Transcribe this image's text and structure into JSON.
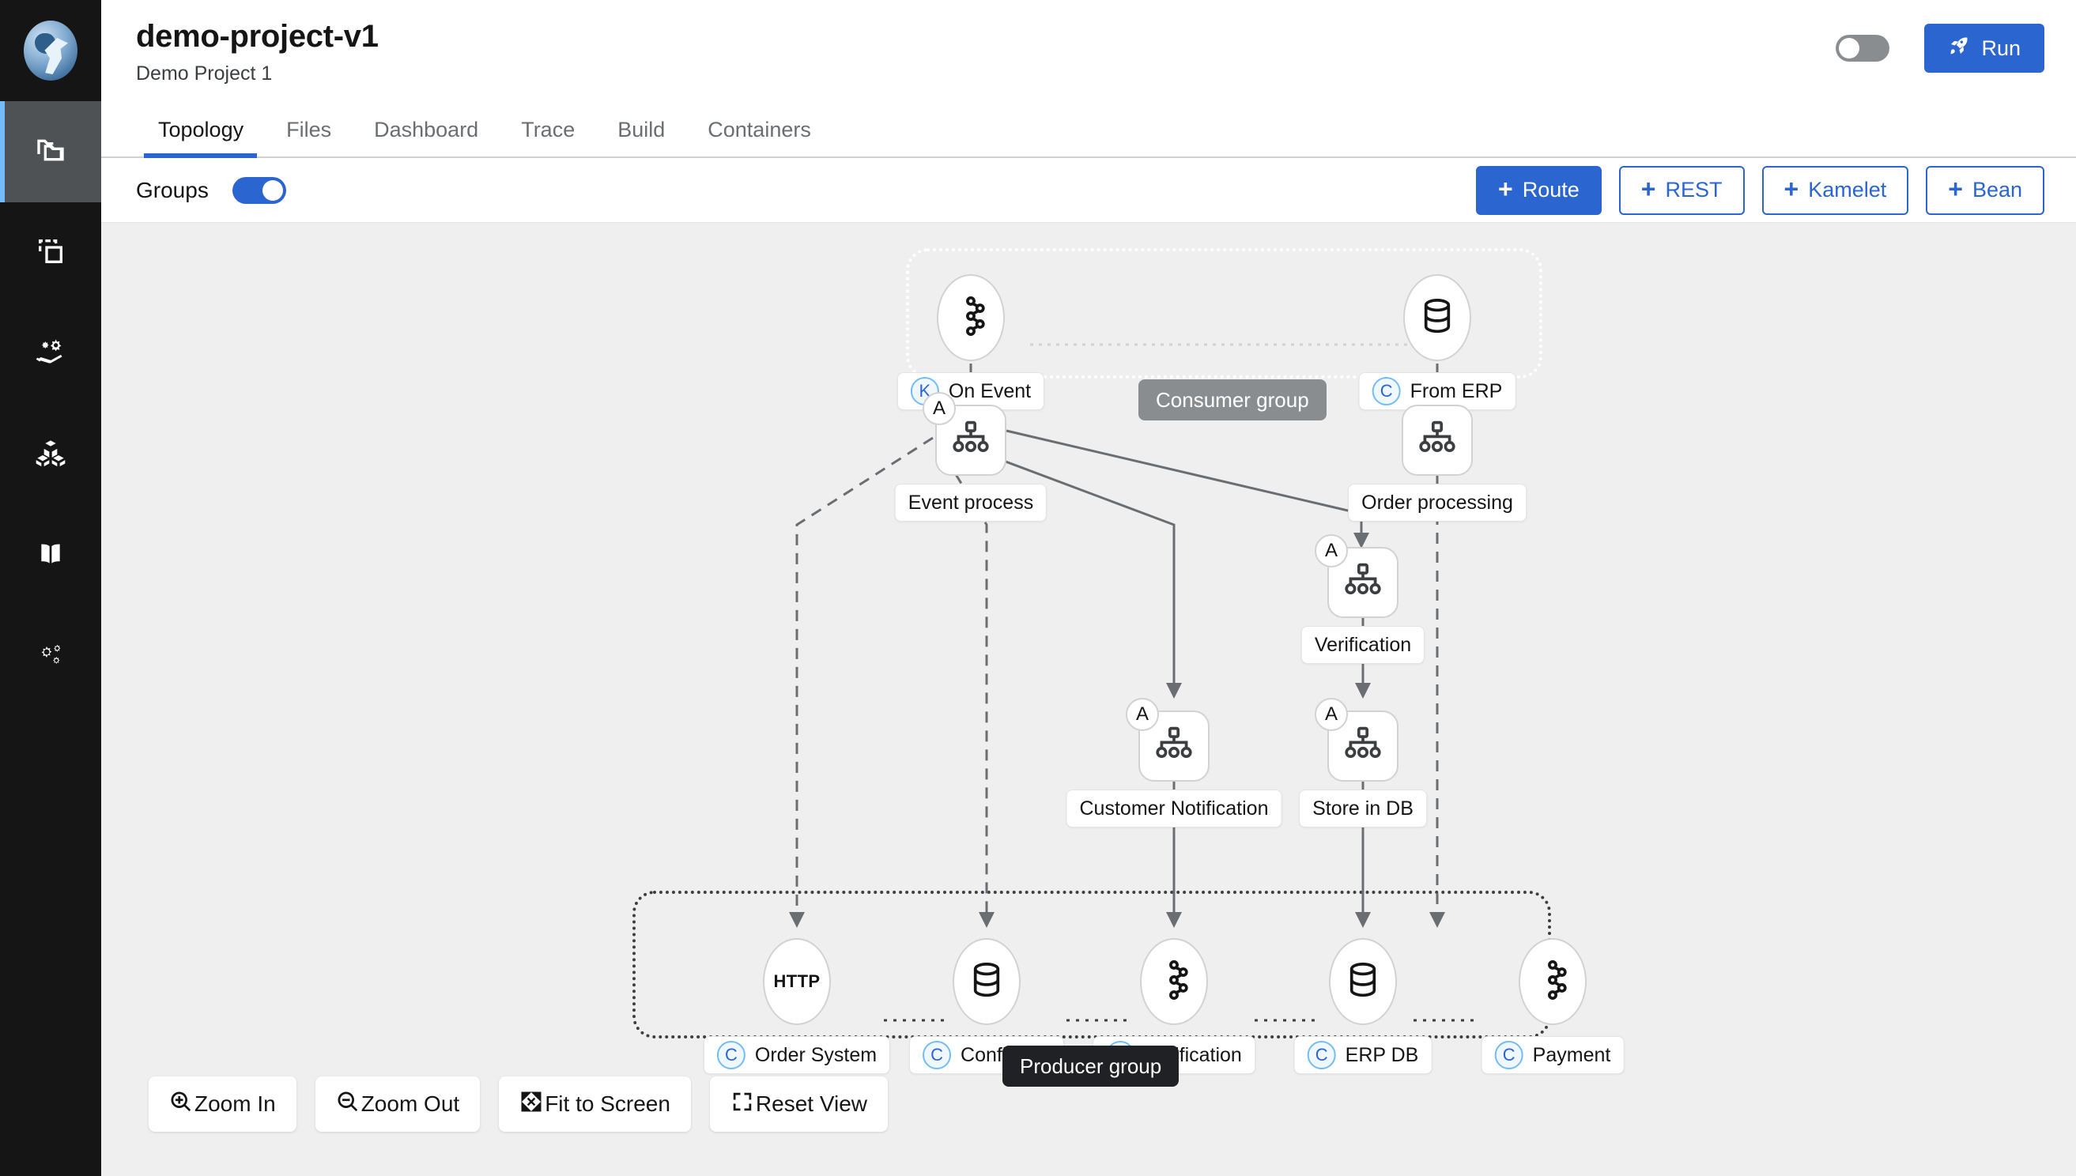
{
  "sidebar": {
    "logo": "karavan-logo",
    "items": [
      {
        "name": "projects",
        "icon": "folders-icon",
        "active": true
      },
      {
        "name": "templates",
        "icon": "copy-icon",
        "active": false
      },
      {
        "name": "services",
        "icon": "services-hand-gear-icon",
        "active": false
      },
      {
        "name": "containers",
        "icon": "cubes-icon",
        "active": false
      },
      {
        "name": "knowledgebase",
        "icon": "book-icon",
        "active": false
      },
      {
        "name": "configuration",
        "icon": "gears-icon",
        "active": false
      }
    ]
  },
  "header": {
    "title": "demo-project-v1",
    "subtitle": "Demo Project 1",
    "dev_mode_toggle": {
      "name": "dev-mode-toggle",
      "on": false
    },
    "run_label": "Run",
    "run_icon": "rocket-icon"
  },
  "tabs": [
    {
      "label": "Topology",
      "active": true
    },
    {
      "label": "Files",
      "active": false
    },
    {
      "label": "Dashboard",
      "active": false
    },
    {
      "label": "Trace",
      "active": false
    },
    {
      "label": "Build",
      "active": false
    },
    {
      "label": "Containers",
      "active": false
    }
  ],
  "toolbar": {
    "groups_label": "Groups",
    "groups_toggle_on": true,
    "actions": [
      {
        "label": "Route",
        "primary": true
      },
      {
        "label": "REST",
        "primary": false
      },
      {
        "label": "Kamelet",
        "primary": false
      },
      {
        "label": "Bean",
        "primary": false
      }
    ]
  },
  "topology": {
    "group_tags": [
      {
        "label": "Consumer group",
        "style": "consumer"
      },
      {
        "label": "Producer group",
        "style": "producer"
      }
    ],
    "nodes": [
      {
        "id": "on-event",
        "label": "On Event",
        "icon": "kafka-icon",
        "shape": "ellipse",
        "chip": "K",
        "badge": null
      },
      {
        "id": "from-erp",
        "label": "From ERP",
        "icon": "database-icon",
        "shape": "ellipse",
        "chip": "C",
        "badge": null
      },
      {
        "id": "event-process",
        "label": "Event process",
        "icon": "route-icon",
        "shape": "rounded",
        "chip": null,
        "badge": "A"
      },
      {
        "id": "order-processing",
        "label": "Order processing",
        "icon": "route-icon",
        "shape": "rounded",
        "chip": null,
        "badge": null
      },
      {
        "id": "verification",
        "label": "Verification",
        "icon": "route-icon",
        "shape": "rounded",
        "chip": null,
        "badge": "A"
      },
      {
        "id": "customer-notification",
        "label": "Customer Notification",
        "icon": "route-icon",
        "shape": "rounded",
        "chip": null,
        "badge": "A"
      },
      {
        "id": "store-in-db",
        "label": "Store in DB",
        "icon": "route-icon",
        "shape": "rounded",
        "chip": null,
        "badge": "A"
      },
      {
        "id": "order-system",
        "label": "Order System",
        "icon": "http-icon",
        "shape": "ellipse",
        "chip": "C",
        "badge": null
      },
      {
        "id": "config-db",
        "label": "Config DB",
        "icon": "database-icon",
        "shape": "ellipse",
        "chip": "C",
        "badge": null
      },
      {
        "id": "notification",
        "label": "Notification",
        "icon": "kafka-icon",
        "shape": "ellipse",
        "chip": "C",
        "badge": null
      },
      {
        "id": "erp-db",
        "label": "ERP DB",
        "icon": "database-icon",
        "shape": "ellipse",
        "chip": "C",
        "badge": null
      },
      {
        "id": "payment",
        "label": "Payment",
        "icon": "kafka-icon",
        "shape": "ellipse",
        "chip": "C",
        "badge": null
      }
    ]
  },
  "view_controls": [
    {
      "label": "Zoom In",
      "icon": "zoom-in-icon"
    },
    {
      "label": "Zoom Out",
      "icon": "zoom-out-icon"
    },
    {
      "label": "Fit to Screen",
      "icon": "fit-screen-icon"
    },
    {
      "label": "Reset View",
      "icon": "reset-view-icon"
    }
  ]
}
